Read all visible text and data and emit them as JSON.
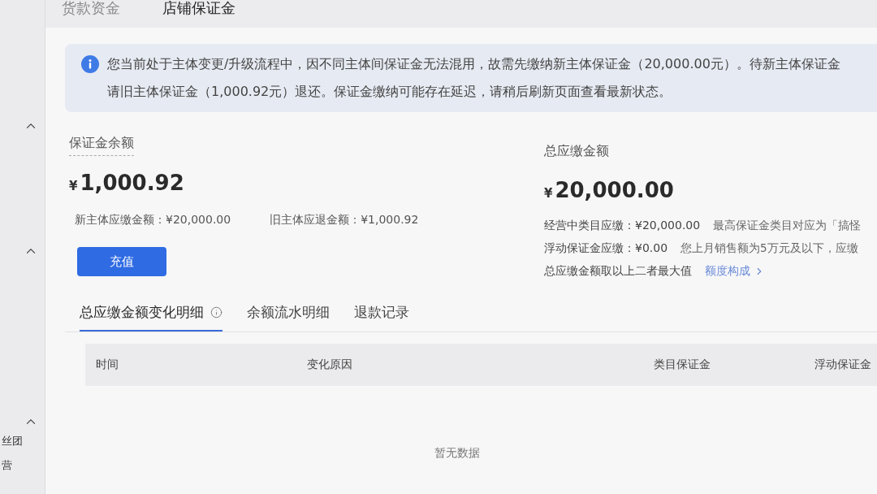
{
  "top_tabs": [
    {
      "label": "货款资金",
      "selected": false
    },
    {
      "label": "店铺保证金",
      "selected": true
    }
  ],
  "sidebar": {
    "groups": [
      {
        "expanded": true
      },
      {
        "expanded": true
      },
      {
        "expanded": true,
        "items": [
          "丝团",
          "营"
        ]
      }
    ]
  },
  "notice": {
    "lines": [
      "您当前处于主体变更/升级流程中，因不同主体间保证金无法混用，故需先缴纳新主体保证金（20,000.00元）。待新主体保证金",
      "请旧主体保证金（1,000.92元）退还。保证金缴纳可能存在延迟，请稍后刷新页面查看最新状态。"
    ]
  },
  "balance": {
    "label": "保证金余额",
    "currency": "¥",
    "amount": "1,000.92",
    "details": [
      "新主体应缴金额：¥20,000.00",
      "旧主体应退金额：¥1,000.92"
    ],
    "button": "充值"
  },
  "total_due": {
    "label": "总应缴金额",
    "currency": "¥",
    "amount": "20,000.00",
    "lines": [
      {
        "text": "经营中类目应缴：¥20,000.00",
        "note": "最高保证金类目对应为「搞怪"
      },
      {
        "text": "浮动保证金应缴：¥0.00",
        "note": "您上月销售额为5万元及以下，应缴"
      }
    ],
    "summary": "总应缴金额取以上二者最大值",
    "link": "额度构成"
  },
  "detail_tabs": [
    {
      "label": "总应缴金额变化明细",
      "selected": true,
      "info": true
    },
    {
      "label": "余额流水明细",
      "selected": false,
      "info": false
    },
    {
      "label": "退款记录",
      "selected": false,
      "info": false
    }
  ],
  "table": {
    "columns": [
      "时间",
      "变化原因",
      "类目保证金",
      "浮动保证金"
    ],
    "empty_text": "暂无数据"
  }
}
